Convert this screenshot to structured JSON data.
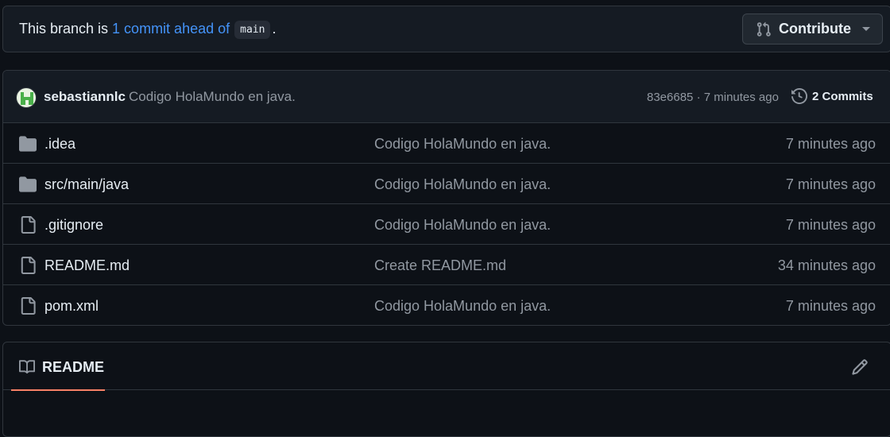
{
  "branch_bar": {
    "prefix": "This branch is",
    "link": "1 commit ahead of",
    "branch": "main",
    "suffix": ".",
    "contribute_label": "Contribute"
  },
  "latest_commit": {
    "author": "sebastiannlc",
    "message": "Codigo HolaMundo en java.",
    "meta": "83e6685 · 7 minutes ago",
    "commits_label": "2 Commits"
  },
  "files": [
    {
      "type": "folder",
      "name": ".idea",
      "message": "Codigo HolaMundo en java.",
      "time": "7 minutes ago"
    },
    {
      "type": "folder",
      "name": "src/main/java",
      "message": "Codigo HolaMundo en java.",
      "time": "7 minutes ago"
    },
    {
      "type": "file",
      "name": ".gitignore",
      "message": "Codigo HolaMundo en java.",
      "time": "7 minutes ago"
    },
    {
      "type": "file",
      "name": "README.md",
      "message": "Create README.md",
      "time": "34 minutes ago"
    },
    {
      "type": "file",
      "name": "pom.xml",
      "message": "Codigo HolaMundo en java.",
      "time": "7 minutes ago"
    }
  ],
  "readme": {
    "tab_label": "README"
  },
  "colors": {
    "background": "#0d1117",
    "link": "#4493f8",
    "muted": "#9198a1",
    "tab_underline": "#f78166"
  }
}
